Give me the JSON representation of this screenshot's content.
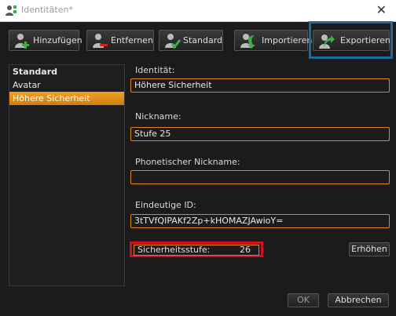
{
  "window": {
    "title": "Identitäten*",
    "close_glyph": "✕"
  },
  "toolbar": {
    "add_label": "Hinzufügen",
    "remove_label": "Entfernen",
    "default_label": "Standard",
    "import_label": "Importieren",
    "export_label": "Exportieren"
  },
  "list": {
    "items": [
      {
        "label": "Standard"
      },
      {
        "label": "Avatar"
      },
      {
        "label": "Höhere Sicherheit"
      }
    ],
    "selected": "Höhere Sicherheit"
  },
  "form": {
    "identity_label": "Identität:",
    "identity_value": "Höhere Sicherheit",
    "nickname_label": "Nickname:",
    "nickname_value": "Stufe 25",
    "phonetic_label": "Phonetischer Nickname:",
    "phonetic_value": "",
    "uid_label": "Eindeutige ID:",
    "uid_value": "3tTVfQIPAKf2Zp+kHOMAZJAwioY=",
    "security_label": "Sicherheitsstufe:",
    "security_value": "26",
    "increase_label": "Erhöhen"
  },
  "footer": {
    "ok_label": "OK",
    "cancel_label": "Abbrechen"
  },
  "colors": {
    "accent_orange": "#e0861c",
    "highlight_red": "#d30f1f",
    "highlight_blue": "#1b6aa0"
  }
}
